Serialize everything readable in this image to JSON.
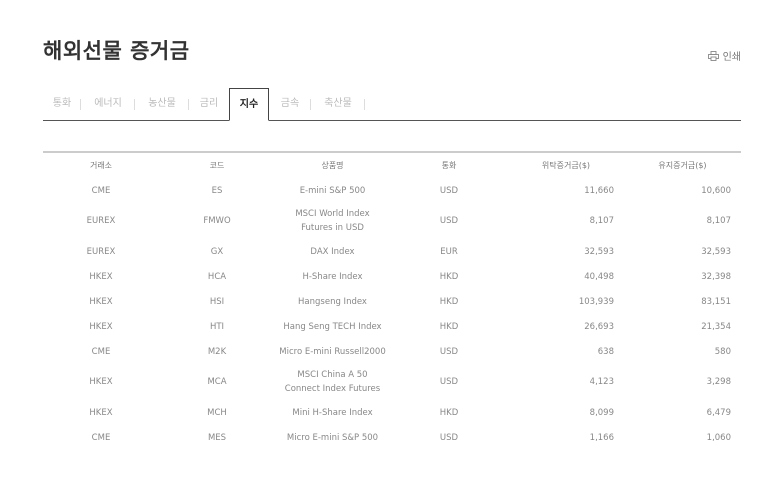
{
  "header": {
    "title": "해외선물 증거금",
    "print_label": "인쇄"
  },
  "tabs": [
    {
      "label": "통화",
      "active": false
    },
    {
      "label": "에너지",
      "active": false
    },
    {
      "label": "농산물",
      "active": false
    },
    {
      "label": "금리",
      "active": false
    },
    {
      "label": "지수",
      "active": true
    },
    {
      "label": "금속",
      "active": false
    },
    {
      "label": "축산물",
      "active": false
    }
  ],
  "table": {
    "columns": [
      "거래소",
      "코드",
      "상품명",
      "통화",
      "위탁증거금($)",
      "유지증거금($)"
    ],
    "rows": [
      {
        "exchange": "CME",
        "code": "ES",
        "name_1": "E-mini S&P 500",
        "name_2": "",
        "currency": "USD",
        "initial": "11,660",
        "maintenance": "10,600"
      },
      {
        "exchange": "EUREX",
        "code": "FMWO",
        "name_1": "MSCI World Index",
        "name_2": "Futures in USD",
        "currency": "USD",
        "initial": "8,107",
        "maintenance": "8,107"
      },
      {
        "exchange": "EUREX",
        "code": "GX",
        "name_1": "DAX Index",
        "name_2": "",
        "currency": "EUR",
        "initial": "32,593",
        "maintenance": "32,593"
      },
      {
        "exchange": "HKEX",
        "code": "HCA",
        "name_1": "H-Share Index",
        "name_2": "",
        "currency": "HKD",
        "initial": "40,498",
        "maintenance": "32,398"
      },
      {
        "exchange": "HKEX",
        "code": "HSI",
        "name_1": "Hangseng Index",
        "name_2": "",
        "currency": "HKD",
        "initial": "103,939",
        "maintenance": "83,151"
      },
      {
        "exchange": "HKEX",
        "code": "HTI",
        "name_1": "Hang Seng TECH Index",
        "name_2": "",
        "currency": "HKD",
        "initial": "26,693",
        "maintenance": "21,354"
      },
      {
        "exchange": "CME",
        "code": "M2K",
        "name_1": "Micro E-mini Russell2000",
        "name_2": "",
        "currency": "USD",
        "initial": "638",
        "maintenance": "580"
      },
      {
        "exchange": "HKEX",
        "code": "MCA",
        "name_1": "MSCI China A 50",
        "name_2": "Connect Index Futures",
        "currency": "USD",
        "initial": "4,123",
        "maintenance": "3,298"
      },
      {
        "exchange": "HKEX",
        "code": "MCH",
        "name_1": "Mini H-Share Index",
        "name_2": "",
        "currency": "HKD",
        "initial": "8,099",
        "maintenance": "6,479"
      },
      {
        "exchange": "CME",
        "code": "MES",
        "name_1": "Micro E-mini S&P 500",
        "name_2": "",
        "currency": "USD",
        "initial": "1,166",
        "maintenance": "1,060"
      }
    ]
  },
  "colors": {
    "active_tab_border": "#444444",
    "inactive_tab_text": "#bbbbbb",
    "cell_text": "#888888"
  }
}
